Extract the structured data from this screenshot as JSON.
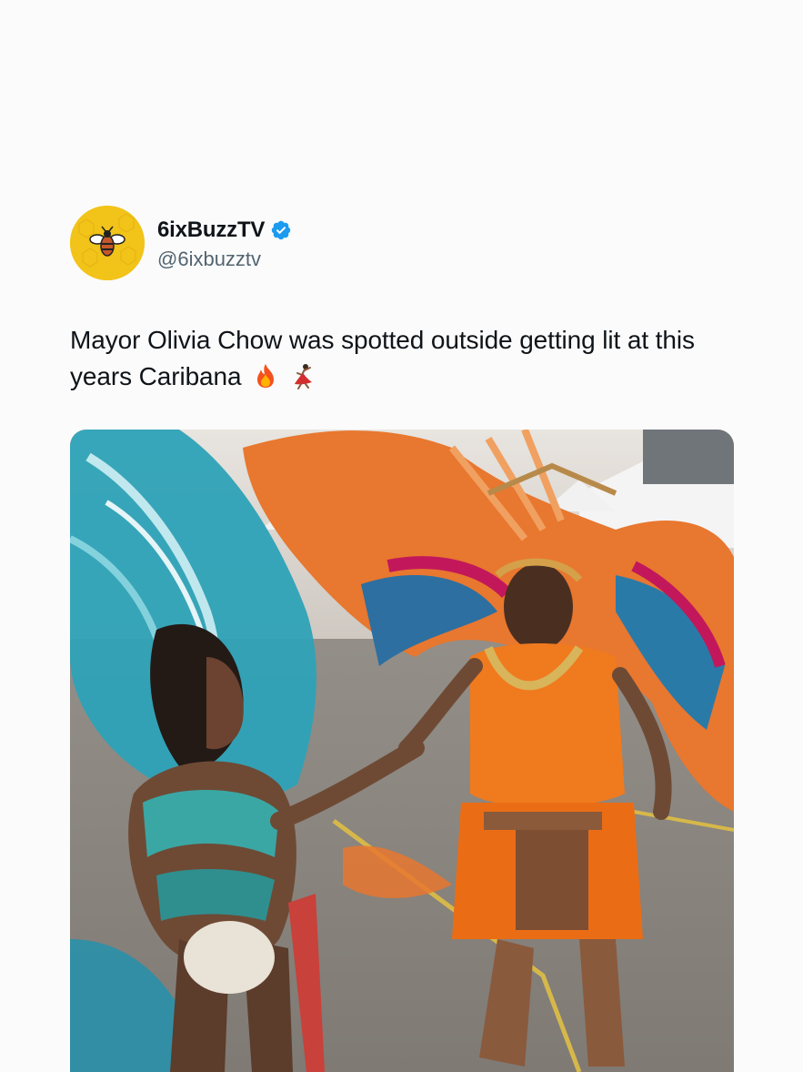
{
  "tweet": {
    "display_name": "6ixBuzzTV",
    "handle": "@6ixbuzztv",
    "verified": true,
    "text": "Mayor Olivia Chow was spotted outside getting lit at this years Caribana",
    "emojis": [
      "fire-emoji",
      "dancer-emoji"
    ],
    "avatar_icon": "bee-logo-icon",
    "colors": {
      "avatar_bg": "#f2c318",
      "verified_blue": "#1d9bf0",
      "handle_gray": "#536471"
    }
  },
  "media": {
    "type": "photo"
  }
}
